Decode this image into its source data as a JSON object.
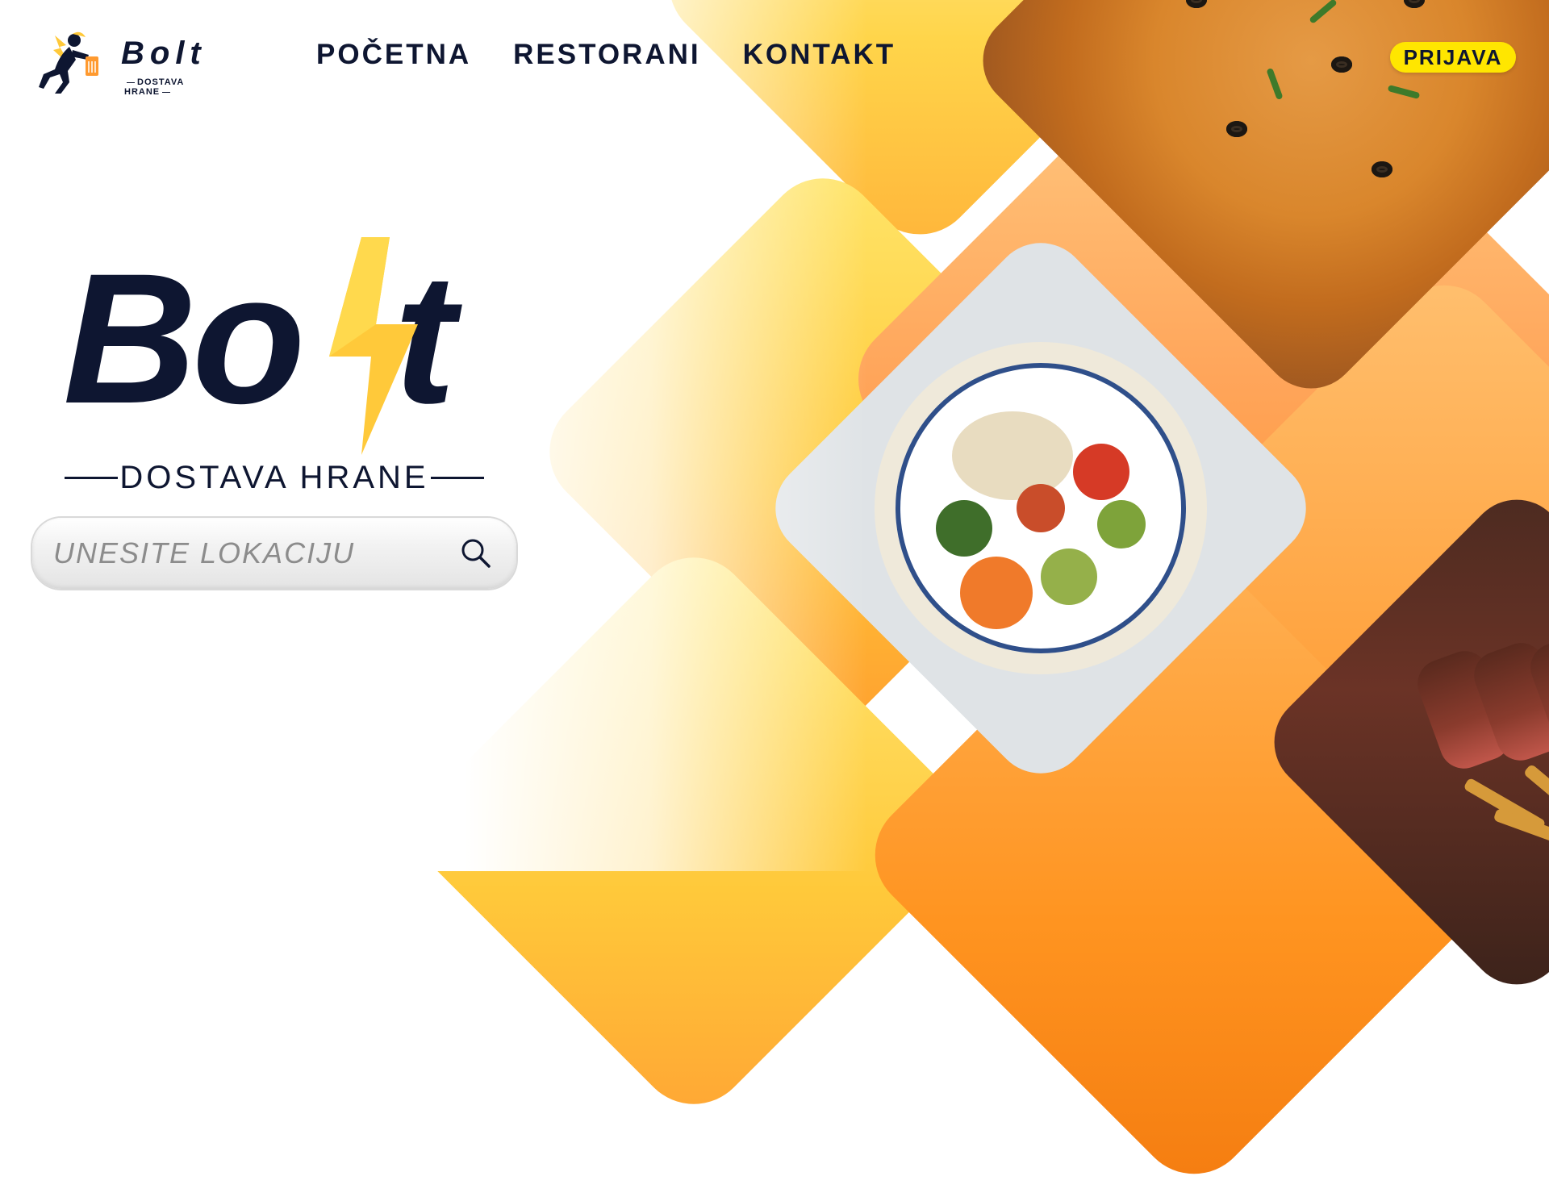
{
  "header": {
    "logo": {
      "word": "Bolt",
      "subtitle": "DOSTAVA HRANE"
    },
    "nav": [
      {
        "label": "POČETNA"
      },
      {
        "label": "RESTORANI"
      },
      {
        "label": "KONTAKT"
      }
    ],
    "login_label": "PRIJAVA"
  },
  "hero": {
    "brand_word": "Bo  t",
    "subtitle": "DOSTAVA HRANE",
    "search": {
      "placeholder": "UNESITE LOKACIJU",
      "icon": "search-icon"
    }
  },
  "colors": {
    "navy": "#0e1631",
    "accent_yellow": "#ffe600",
    "bolt_yellow": "#ffc93a",
    "orange": "#ff9420"
  },
  "images": [
    "pizza",
    "vegetable-quinoa-bowl",
    "steak-and-fries"
  ]
}
